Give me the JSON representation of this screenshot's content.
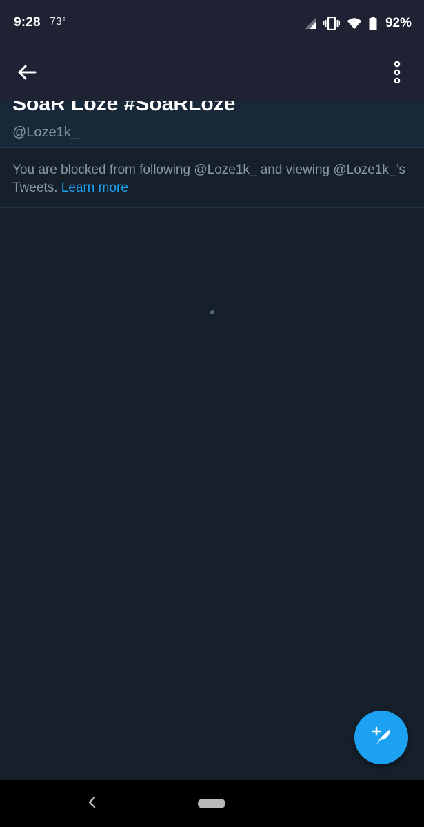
{
  "status_bar": {
    "time": "9:28",
    "temperature": "73°",
    "battery_percent": "92%",
    "icons": [
      "signal-icon",
      "vibrate-icon",
      "wifi-icon",
      "battery-icon"
    ]
  },
  "app_bar": {
    "back_icon": "arrow-left-icon",
    "more_icon": "more-vertical-icon"
  },
  "profile": {
    "name": "SoaR Loze #SoaRLoze",
    "handle": "@Loze1k_"
  },
  "blocked_notice": {
    "text": "You are blocked from following @Loze1k_ and viewing @Loze1k_’s Tweets.",
    "link": "Learn more"
  },
  "fab": {
    "icon": "compose-tweet-icon",
    "color": "#1da1f2"
  },
  "nav_bar": {
    "back_icon": "nav-back-icon",
    "home_icon": "nav-home-pill"
  },
  "colors": {
    "background": "#16202b",
    "header": "#1f2233",
    "accent": "#1da1f2",
    "secondary_text": "#8899a6"
  }
}
